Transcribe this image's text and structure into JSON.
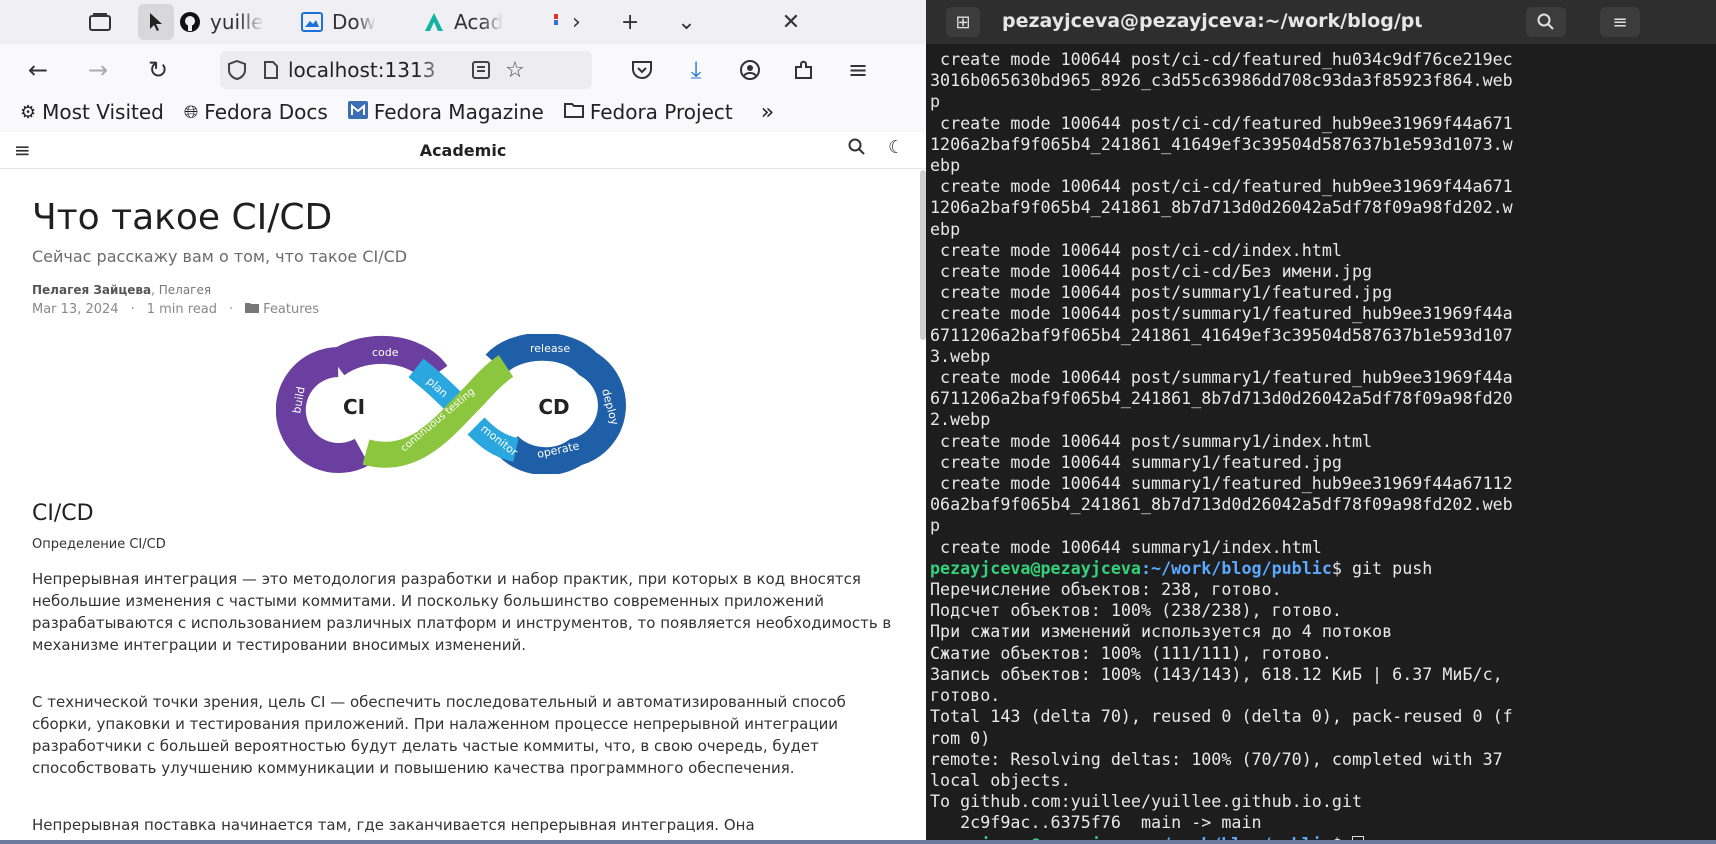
{
  "browser": {
    "tabs": [
      {
        "label": "yuille",
        "icon": "github-icon"
      },
      {
        "label": "Dow",
        "icon": "download-page-icon"
      },
      {
        "label": "Acad",
        "icon": "academic-icon"
      },
      {
        "label": "",
        "icon": "tab-favicon-icon"
      }
    ],
    "url": "localhost:1313",
    "bookmarks": [
      "Most Visited",
      "Fedora Docs",
      "Fedora Magazine",
      "Fedora Project"
    ]
  },
  "site": {
    "title": "Academic"
  },
  "post": {
    "title": "Что такое CI/CD",
    "subtitle": "Сейчас расскажу вам о том, что такое CI/CD",
    "author_main": "Пелагея Зайцева",
    "author_second": ", Пелагея",
    "date": "Mar 13, 2024",
    "read_time": "1 min read",
    "category": "Features",
    "diagram": {
      "ci": "CI",
      "cd": "CD",
      "code": "code",
      "plan": "plan",
      "build": "build",
      "continuous": "continuous testing",
      "release": "release",
      "deploy": "deploy",
      "monitor": "monitor",
      "operate": "operate",
      "colors": {
        "purple": "#6b3fa0",
        "blue": "#1f5fa8",
        "light_blue": "#2aa7df",
        "green": "#8cc63f"
      }
    },
    "section_heading": "CI/CD",
    "section_subheading": "Определение CI/CD",
    "paragraphs": [
      "Непрерывная интеграция — это методология разработки и набор практик, при которых в код вносятся небольшие изменения с частыми коммитами. И поскольку большинство современных приложений разрабатываются с использованием различных платформ и инструментов, то появляется необходимость в механизме интеграции и тестировании вносимых изменений.",
      "С технической точки зрения, цель CI — обеспечить последовательный и автоматизированный способ сборки, упаковки и тестирования приложений. При налаженном процессе непрерывной интеграции разработчики с большей вероятностью будут делать частые коммиты, что, в свою очередь, будет способствовать улучшению коммуникации и повышению качества программного обеспечения.",
      "Непрерывная поставка начинается там, где заканчивается непрерывная интеграция. Она"
    ]
  },
  "terminal": {
    "title": "pezayjceva@pezayjceva:~/work/blog/public",
    "lines_before": [
      " create mode 100644 post/ci-cd/featured_hu034c9df76ce219ec",
      "3016b065630bd965_8926_c3d55c63986dd708c93da3f85923f864.web",
      "p",
      " create mode 100644 post/ci-cd/featured_hub9ee31969f44a671",
      "1206a2baf9f065b4_241861_41649ef3c39504d587637b1e593d1073.w",
      "ebp",
      " create mode 100644 post/ci-cd/featured_hub9ee31969f44a671",
      "1206a2baf9f065b4_241861_8b7d713d0d26042a5df78f09a98fd202.w",
      "ebp",
      " create mode 100644 post/ci-cd/index.html",
      " create mode 100644 post/ci-cd/Без имени.jpg",
      " create mode 100644 post/summary1/featured.jpg",
      " create mode 100644 post/summary1/featured_hub9ee31969f44a",
      "6711206a2baf9f065b4_241861_41649ef3c39504d587637b1e593d107",
      "3.webp",
      " create mode 100644 post/summary1/featured_hub9ee31969f44a",
      "6711206a2baf9f065b4_241861_8b7d713d0d26042a5df78f09a98fd20",
      "2.webp",
      " create mode 100644 post/summary1/index.html",
      " create mode 100644 summary1/featured.jpg",
      " create mode 100644 summary1/featured_hub9ee31969f44a67112",
      "06a2baf9f065b4_241861_8b7d713d0d26042a5df78f09a98fd202.web",
      "p",
      " create mode 100644 summary1/index.html"
    ],
    "prompt_user": "pezayjceva@pezayjceva",
    "prompt_path": ":~/work/blog/public",
    "command": "$ git push",
    "lines_after": [
      "Перечисление объектов: 238, готово.",
      "Подсчет объектов: 100% (238/238), готово.",
      "При сжатии изменений используется до 4 потоков",
      "Сжатие объектов: 100% (111/111), готово.",
      "Запись объектов: 100% (143/143), 618.12 КиБ | 6.37 МиБ/с,",
      "готово.",
      "Total 143 (delta 70), reused 0 (delta 0), pack-reused 0 (f",
      "rom 0)",
      "remote: Resolving deltas: 100% (70/70), completed with 37",
      "local objects.",
      "To github.com:yuillee/yuillee.github.io.git",
      "   2c9f9ac..6375f76  main -> main"
    ]
  }
}
